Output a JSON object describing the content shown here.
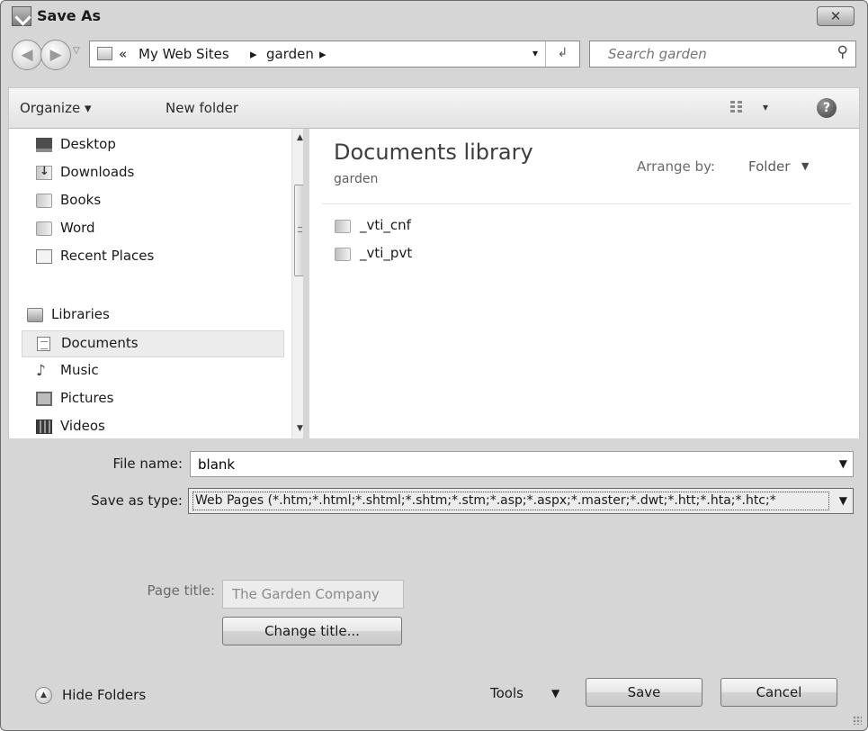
{
  "window": {
    "title": "Save As",
    "close_glyph": "✕"
  },
  "navigation": {
    "back_glyph": "◀",
    "forward_glyph": "▶",
    "dropdown_glyph": "▽",
    "address": {
      "overflow": "«",
      "parts": [
        "My Web Sites",
        "▸",
        "garden",
        "▸"
      ],
      "dropdown_glyph": "▾",
      "refresh_glyph": "↲"
    },
    "search": {
      "placeholder": "Search garden",
      "icon_glyph": "⚲"
    }
  },
  "toolbar": {
    "organize": "Organize ▾",
    "new_folder": "New folder",
    "views_dropdown": "▾",
    "help": "?"
  },
  "sidebar": {
    "items": [
      {
        "label": "Desktop",
        "icon": "desktop-icon"
      },
      {
        "label": "Downloads",
        "icon": "downloads-icon"
      },
      {
        "label": "Books",
        "icon": "folder-icon"
      },
      {
        "label": "Word",
        "icon": "folder-icon"
      },
      {
        "label": "Recent Places",
        "icon": "recent-places-icon"
      },
      {
        "label": "Libraries",
        "icon": "libraries-icon"
      },
      {
        "label": "Documents",
        "icon": "documents-icon",
        "selected": true
      },
      {
        "label": "Music",
        "icon": "music-icon"
      },
      {
        "label": "Pictures",
        "icon": "pictures-icon"
      },
      {
        "label": "Videos",
        "icon": "videos-icon"
      }
    ],
    "scroll_up": "▲",
    "scroll_down": "▼"
  },
  "content": {
    "library_title": "Documents library",
    "library_subtitle": "garden",
    "arrange_label": "Arrange by:",
    "arrange_value": "Folder",
    "arrange_drop": "▼",
    "files": [
      "_vti_cnf",
      "_vti_pvt"
    ]
  },
  "form": {
    "file_name_label": "File name:",
    "file_name_value": "blank",
    "save_type_label": "Save as type:",
    "save_type_value": "Web Pages (*.htm;*.html;*.shtml;*.shtm;*.stm;*.asp;*.aspx;*.master;*.dwt;*.htt;*.hta;*.htc;*",
    "combo_drop": "▼",
    "page_title_label": "Page title:",
    "page_title_value": "The Garden Company",
    "change_title_button": "Change title..."
  },
  "footer": {
    "hide_folders": "Hide Folders",
    "hide_folders_glyph": "▲",
    "tools": "Tools",
    "tools_drop": "▼",
    "save_button": "Save",
    "cancel_button": "Cancel"
  }
}
